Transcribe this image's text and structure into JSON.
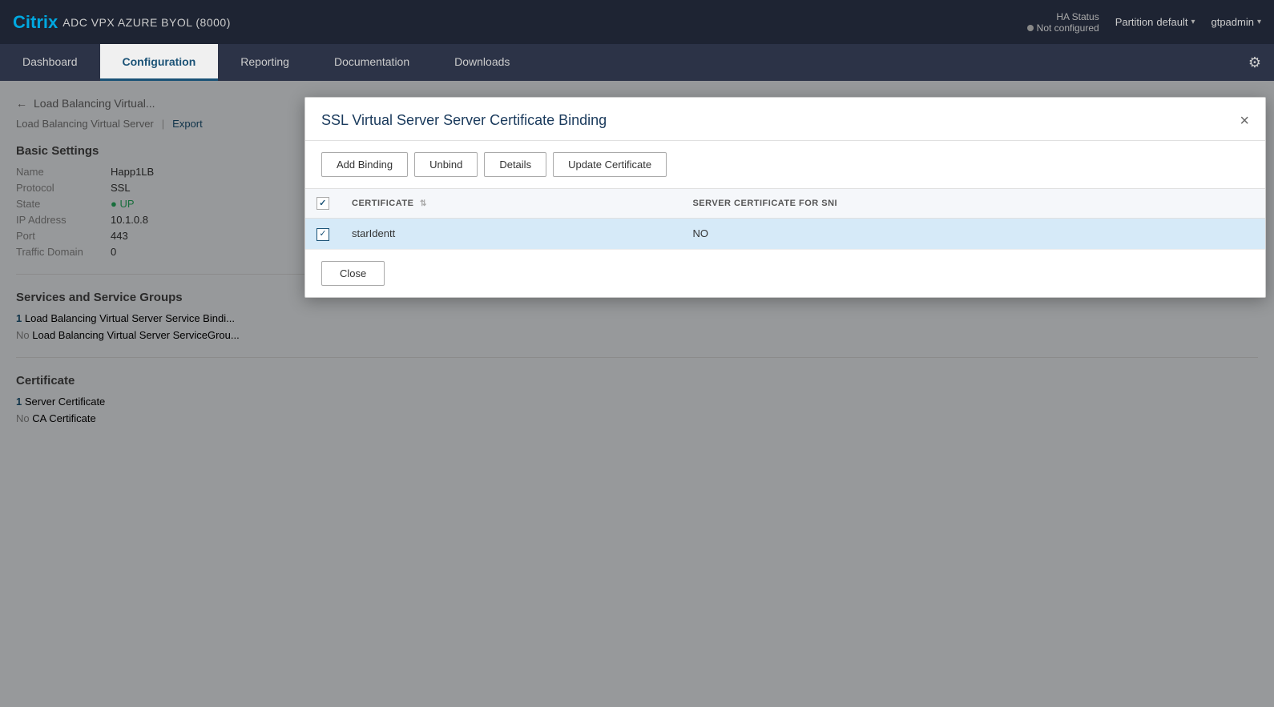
{
  "header": {
    "brand_citrix": "Citrix",
    "brand_product": "ADC VPX AZURE BYOL (8000)",
    "ha_status_label": "HA Status",
    "ha_status_value": "Not configured",
    "partition_label": "Partition",
    "partition_value": "default",
    "user": "gtpadmin"
  },
  "nav": {
    "tabs": [
      {
        "id": "dashboard",
        "label": "Dashboard",
        "active": false
      },
      {
        "id": "configuration",
        "label": "Configuration",
        "active": true
      },
      {
        "id": "reporting",
        "label": "Reporting",
        "active": false
      },
      {
        "id": "documentation",
        "label": "Documentation",
        "active": false
      },
      {
        "id": "downloads",
        "label": "Downloads",
        "active": false
      }
    ]
  },
  "bg_page": {
    "back_label": "Load Balancing Virtual...",
    "breadcrumb_parent": "Load Balancing Virtual Server",
    "breadcrumb_link": "Export",
    "basic_settings_title": "Basic Settings",
    "fields": [
      {
        "label": "Name",
        "value": "Happ1LB",
        "type": "normal"
      },
      {
        "label": "Protocol",
        "value": "SSL",
        "type": "normal"
      },
      {
        "label": "State",
        "value": "UP",
        "type": "up"
      },
      {
        "label": "IP Address",
        "value": "10.1.0.8",
        "type": "normal"
      },
      {
        "label": "Port",
        "value": "443",
        "type": "normal"
      },
      {
        "label": "Traffic Domain",
        "value": "0",
        "type": "normal"
      }
    ],
    "services_title": "Services and Service Groups",
    "service_links": [
      {
        "prefix": "1",
        "suffix": "Load Balancing Virtual Server Service Bindi..."
      },
      {
        "prefix": "No",
        "suffix": "Load Balancing Virtual Server ServiceGrou..."
      }
    ],
    "certificate_title": "Certificate",
    "cert_links": [
      {
        "prefix": "1",
        "suffix": "Server Certificate"
      },
      {
        "prefix": "No",
        "suffix": "CA Certificate"
      }
    ]
  },
  "modal": {
    "title": "SSL Virtual Server Server Certificate Binding",
    "close_label": "×",
    "buttons": [
      {
        "id": "add-binding",
        "label": "Add Binding"
      },
      {
        "id": "unbind",
        "label": "Unbind"
      },
      {
        "id": "details",
        "label": "Details"
      },
      {
        "id": "update-certificate",
        "label": "Update Certificate"
      }
    ],
    "table": {
      "columns": [
        {
          "id": "checkbox",
          "label": ""
        },
        {
          "id": "certificate",
          "label": "CERTIFICATE",
          "sortable": true
        },
        {
          "id": "sni",
          "label": "SERVER CERTIFICATE FOR SNI",
          "sortable": false
        }
      ],
      "rows": [
        {
          "certificate": "starIdentt",
          "sni": "NO",
          "selected": true,
          "checked": true
        }
      ]
    },
    "footer_close": "Close"
  }
}
